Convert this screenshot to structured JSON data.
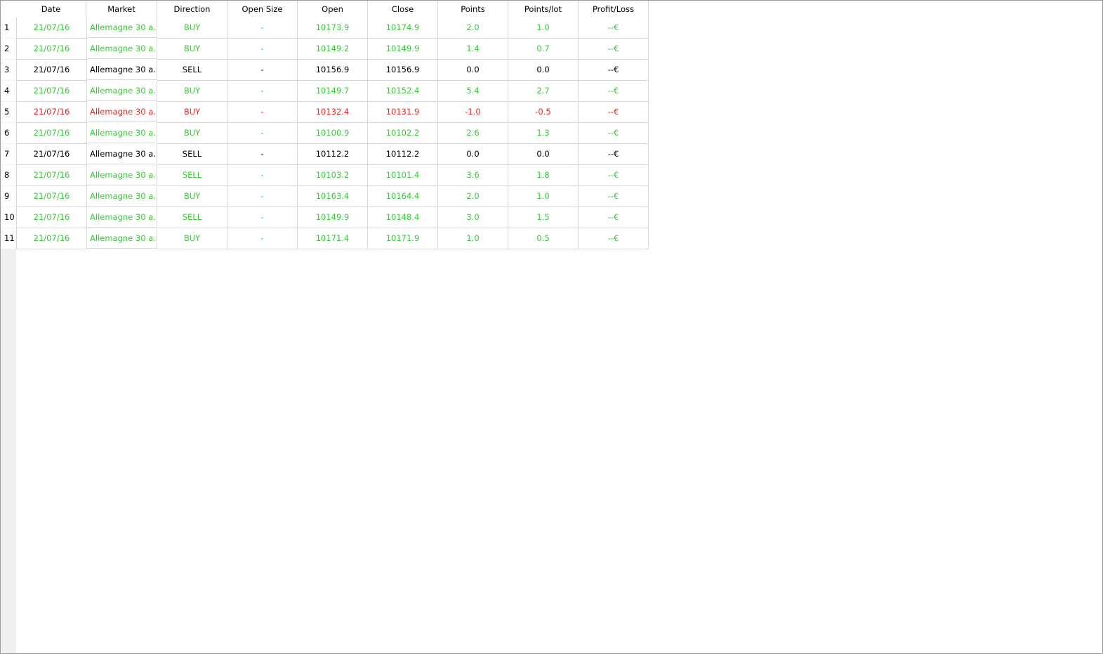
{
  "table": {
    "columns": [
      "Date",
      "Market",
      "Direction",
      "Open Size",
      "Open",
      "Close",
      "Points",
      "Points/lot",
      "Profit/Loss"
    ],
    "colors": {
      "green": "#33cc33",
      "red": "#ee2222",
      "black": "#000000"
    },
    "rows": [
      {
        "num": "1",
        "status": "green",
        "date": "21/07/16",
        "market": "Allemagne 30 a...",
        "direction": "BUY",
        "open_size": "-",
        "open": "10173.9",
        "close": "10174.9",
        "points": "2.0",
        "points_lot": "1.0",
        "pl": "--€"
      },
      {
        "num": "2",
        "status": "green",
        "date": "21/07/16",
        "market": "Allemagne 30 a...",
        "direction": "BUY",
        "open_size": "-",
        "open": "10149.2",
        "close": "10149.9",
        "points": "1.4",
        "points_lot": "0.7",
        "pl": "--€"
      },
      {
        "num": "3",
        "status": "black",
        "date": "21/07/16",
        "market": "Allemagne 30 a...",
        "direction": "SELL",
        "open_size": "-",
        "open": "10156.9",
        "close": "10156.9",
        "points": "0.0",
        "points_lot": "0.0",
        "pl": "--€"
      },
      {
        "num": "4",
        "status": "green",
        "date": "21/07/16",
        "market": "Allemagne 30 a...",
        "direction": "BUY",
        "open_size": "-",
        "open": "10149.7",
        "close": "10152.4",
        "points": "5.4",
        "points_lot": "2.7",
        "pl": "--€"
      },
      {
        "num": "5",
        "status": "red",
        "date": "21/07/16",
        "market": "Allemagne 30 a...",
        "direction": "BUY",
        "open_size": "-",
        "open": "10132.4",
        "close": "10131.9",
        "points": "-1.0",
        "points_lot": "-0.5",
        "pl": "--€"
      },
      {
        "num": "6",
        "status": "green",
        "date": "21/07/16",
        "market": "Allemagne 30 a...",
        "direction": "BUY",
        "open_size": "-",
        "open": "10100.9",
        "close": "10102.2",
        "points": "2.6",
        "points_lot": "1.3",
        "pl": "--€"
      },
      {
        "num": "7",
        "status": "black",
        "date": "21/07/16",
        "market": "Allemagne 30 a...",
        "direction": "SELL",
        "open_size": "-",
        "open": "10112.2",
        "close": "10112.2",
        "points": "0.0",
        "points_lot": "0.0",
        "pl": "--€"
      },
      {
        "num": "8",
        "status": "green",
        "date": "21/07/16",
        "market": "Allemagne 30 a...",
        "direction": "SELL",
        "open_size": "-",
        "open": "10103.2",
        "close": "10101.4",
        "points": "3.6",
        "points_lot": "1.8",
        "pl": "--€"
      },
      {
        "num": "9",
        "status": "green",
        "date": "21/07/16",
        "market": "Allemagne 30 a...",
        "direction": "BUY",
        "open_size": "-",
        "open": "10163.4",
        "close": "10164.4",
        "points": "2.0",
        "points_lot": "1.0",
        "pl": "--€"
      },
      {
        "num": "10",
        "status": "green",
        "date": "21/07/16",
        "market": "Allemagne 30 a...",
        "direction": "SELL",
        "open_size": "-",
        "open": "10149.9",
        "close": "10148.4",
        "points": "3.0",
        "points_lot": "1.5",
        "pl": "--€"
      },
      {
        "num": "11",
        "status": "green",
        "date": "21/07/16",
        "market": "Allemagne 30 a...",
        "direction": "BUY",
        "open_size": "-",
        "open": "10171.4",
        "close": "10171.9",
        "points": "1.0",
        "points_lot": "0.5",
        "pl": "--€"
      }
    ]
  }
}
